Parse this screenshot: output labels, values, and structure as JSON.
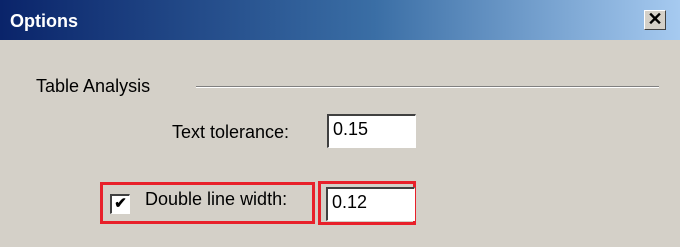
{
  "window": {
    "title": "Options",
    "close_glyph": "✕"
  },
  "group": {
    "label": "Table Analysis"
  },
  "fields": {
    "text_tolerance": {
      "label": "Text tolerance:",
      "value": "0.15"
    },
    "double_line_width": {
      "label": "Double line width:",
      "value": "0.12",
      "checked": true,
      "check_glyph": "✔"
    }
  },
  "colors": {
    "highlight": "#e8202a",
    "title_gradient_start": "#0a246a",
    "title_gradient_end": "#a6caf0",
    "dialog_face": "#d4d0c8"
  },
  "icons": {
    "close": "close-icon",
    "checkmark": "checkmark-icon"
  }
}
